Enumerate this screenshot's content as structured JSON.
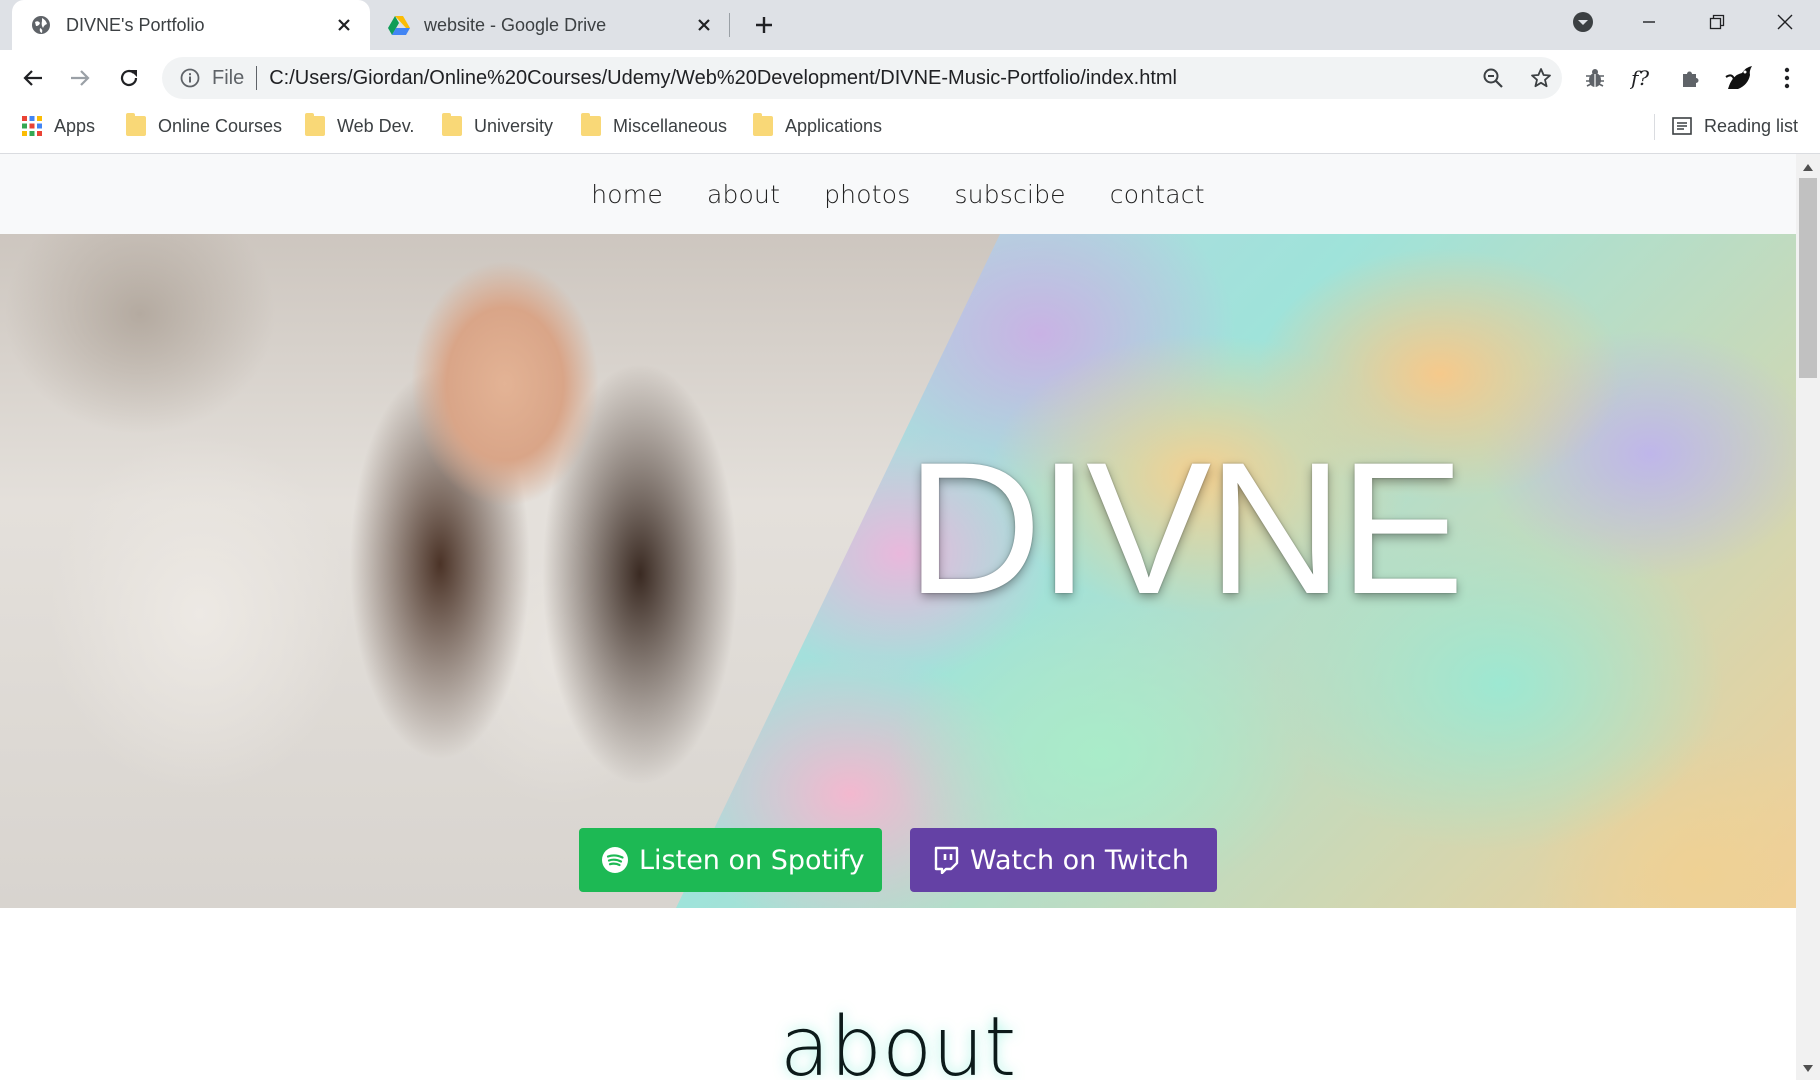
{
  "browser": {
    "tabs": [
      {
        "title": "DIVNE's Portfolio",
        "active": true,
        "favicon": "globe-icon"
      },
      {
        "title": "website - Google Drive",
        "active": false,
        "favicon": "google-drive-icon"
      }
    ],
    "address": {
      "scheme_label": "File",
      "url": "C:/Users/Giordan/Online%20Courses/Udemy/Web%20Development/DIVNE-Music-Portfolio/index.html"
    },
    "bookmarks": [
      {
        "label": "Apps",
        "icon": "apps-grid-icon"
      },
      {
        "label": "Online Courses",
        "icon": "folder-icon"
      },
      {
        "label": "Web Dev.",
        "icon": "folder-icon"
      },
      {
        "label": "University",
        "icon": "folder-icon"
      },
      {
        "label": "Miscellaneous",
        "icon": "folder-icon"
      },
      {
        "label": "Applications",
        "icon": "folder-icon"
      }
    ],
    "reading_list": "Reading list"
  },
  "site": {
    "nav": [
      "home",
      "about",
      "photos",
      "subscibe",
      "contact"
    ],
    "hero": {
      "title": "DIVNE",
      "spotify_label": "Listen on Spotify",
      "twitch_label": "Watch on Twitch"
    },
    "about_heading": "about"
  },
  "colors": {
    "spotify": "#1db954",
    "twitch": "#6441a5",
    "tabstrip": "#dee1e6"
  }
}
